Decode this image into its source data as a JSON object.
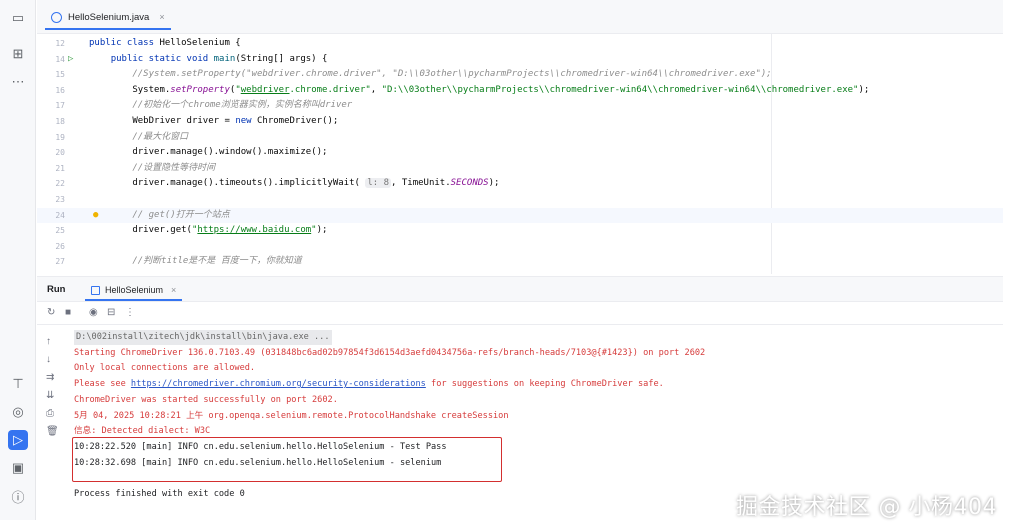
{
  "editor_tab": {
    "title": "HelloSelenium.java",
    "close": "×"
  },
  "code_lines": [
    {
      "num": "12",
      "parts": [
        [
          "kw",
          "public class "
        ],
        [
          "",
          "HelloSelenium {"
        ]
      ]
    },
    {
      "num": "14",
      "parts": [
        [
          "",
          "    "
        ],
        [
          "kw",
          "public static void "
        ],
        [
          "mt",
          "main"
        ],
        [
          "",
          "(String[] args) {"
        ]
      ]
    },
    {
      "num": "15",
      "parts": [
        [
          "cm",
          "        //System.setProperty(\"webdriver.chrome.driver\", \"D:\\\\03other\\\\pycharmProjects\\\\chromedriver-win64\\\\chromedriver.exe\");"
        ]
      ]
    },
    {
      "num": "16",
      "parts": [
        [
          "",
          "        System."
        ],
        [
          "it",
          "setProperty"
        ],
        [
          "",
          "("
        ],
        [
          "st",
          "\""
        ],
        [
          "lk",
          "webdriver"
        ],
        [
          "st",
          ".chrome.driver\""
        ],
        [
          "",
          ", "
        ],
        [
          "st",
          "\"D:\\\\03other\\\\pycharmProjects\\\\chromedriver-win64\\\\chromedriver-win64\\\\chromedriver.exe\""
        ],
        [
          "",
          ");"
        ]
      ]
    },
    {
      "num": "17",
      "parts": [
        [
          "cm",
          "        //初始化一个chrome浏览器实例，实例名称叫driver"
        ]
      ]
    },
    {
      "num": "18",
      "parts": [
        [
          "",
          "        WebDriver driver = "
        ],
        [
          "kw",
          "new "
        ],
        [
          "",
          "ChromeDriver();"
        ]
      ]
    },
    {
      "num": "19",
      "parts": [
        [
          "cm",
          "        //最大化窗口"
        ]
      ]
    },
    {
      "num": "20",
      "parts": [
        [
          "",
          "        driver.manage().window().maximize();"
        ]
      ]
    },
    {
      "num": "21",
      "parts": [
        [
          "cm",
          "        //设置隐性等待时间"
        ]
      ]
    },
    {
      "num": "22",
      "parts": [
        [
          "",
          "        driver.manage().timeouts().implicitlyWait( "
        ],
        [
          "hint",
          "l: 8"
        ],
        [
          "",
          ", TimeUnit."
        ],
        [
          "it",
          "SECONDS"
        ],
        [
          "",
          ");"
        ]
      ]
    },
    {
      "num": "23",
      "parts": [
        [
          "",
          ""
        ]
      ]
    },
    {
      "num": "24",
      "parts": [
        [
          "cm",
          "        // get()打开一个站点"
        ]
      ]
    },
    {
      "num": "25",
      "parts": [
        [
          "",
          "        driver.get("
        ],
        [
          "st",
          "\""
        ],
        [
          "lk",
          "https://www.baidu.com"
        ],
        [
          "st",
          "\""
        ],
        [
          "",
          ");"
        ]
      ]
    },
    {
      "num": "26",
      "parts": [
        [
          "",
          ""
        ]
      ]
    },
    {
      "num": "27",
      "parts": [
        [
          "cm",
          "        //判断title是不是 百度一下，你就知道"
        ]
      ]
    }
  ],
  "run_panel": {
    "title": "Run",
    "tab_label": "HelloSelenium",
    "tab_close": "×"
  },
  "console_lines": [
    {
      "style": "cmd",
      "text": "D:\\002install\\zitech\\jdk\\install\\bin\\java.exe ..."
    },
    {
      "style": "red",
      "text": "Starting ChromeDriver 136.0.7103.49 (031848bc6ad02b97854f3d6154d3aefd0434756a-refs/branch-heads/7103@{#1423}) on port 2602"
    },
    {
      "style": "red",
      "text": "Only local connections are allowed."
    },
    {
      "style": "red",
      "pre": "Please see ",
      "link": "https://chromedriver.chromium.org/security-considerations",
      "post": " for suggestions on keeping ChromeDriver safe."
    },
    {
      "style": "red",
      "text": "ChromeDriver was started successfully on port 2602."
    },
    {
      "style": "red",
      "text": "5月 04, 2025 10:28:21 上午 org.openqa.selenium.remote.ProtocolHandshake createSession"
    },
    {
      "style": "red",
      "text": "信息: Detected dialect: W3C"
    },
    {
      "style": "black",
      "text": "10:28:22.520 [main] INFO cn.edu.selenium.hello.HelloSelenium - Test Pass"
    },
    {
      "style": "black",
      "text": "10:28:32.698 [main] INFO cn.edu.selenium.hello.HelloSelenium - selenium"
    },
    {
      "style": "black",
      "text": ""
    },
    {
      "style": "black",
      "text": "Process finished with exit code 0"
    }
  ],
  "watermark": "掘金技术社区 @ 小杨404",
  "colors": {
    "accent": "#3574f0",
    "error_text": "#d63b3b",
    "highlight_box": "#d32f2f"
  },
  "icons": {
    "activity": [
      "folder-icon",
      "structure-icon",
      "more-icon",
      "build-icon",
      "debug-icon",
      "run-icon",
      "terminal-icon",
      "problems-icon"
    ],
    "toolbar": [
      "rerun-icon",
      "stop-icon",
      "screenshot-icon",
      "layout-icon",
      "options-icon"
    ],
    "side": [
      "scroll-up-icon",
      "scroll-down-icon",
      "soft-wrap-icon",
      "scroll-to-end-icon",
      "print-icon",
      "clear-icon"
    ]
  }
}
